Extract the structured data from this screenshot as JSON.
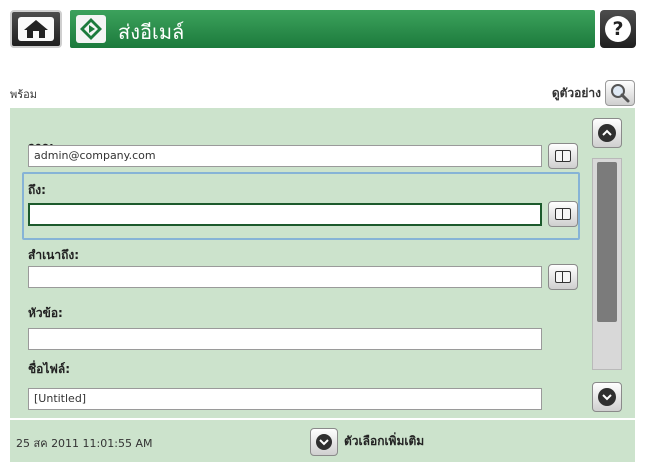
{
  "header": {
    "home_icon": "home-icon",
    "title": "ส่งอีเมล์",
    "title_icon": "diamond-send-icon",
    "help_icon": "help-icon",
    "help_glyph": "?"
  },
  "status": {
    "text": "พร้อม",
    "preview_label": "ดูตัวอย่าง",
    "preview_icon": "magnifier-icon"
  },
  "form": {
    "from_label": "จาก:",
    "from_value": "admin@company.com",
    "to_label": "ถึง:",
    "to_value": "",
    "cc_label": "สำเนาถึง:",
    "cc_value": "",
    "subject_label": "หัวข้อ:",
    "subject_value": "",
    "filename_label": "ชื่อไฟล์:",
    "filename_value": "[Untitled]"
  },
  "footer": {
    "datetime": "25 สค 2011 11:01:55 AM",
    "more_options_label": "ตัวเลือกเพิ่มเติม"
  },
  "colors": {
    "accent_green": "#1c7a3c",
    "panel_bg": "#cce3cc",
    "focus_ring": "#86b3d6"
  }
}
